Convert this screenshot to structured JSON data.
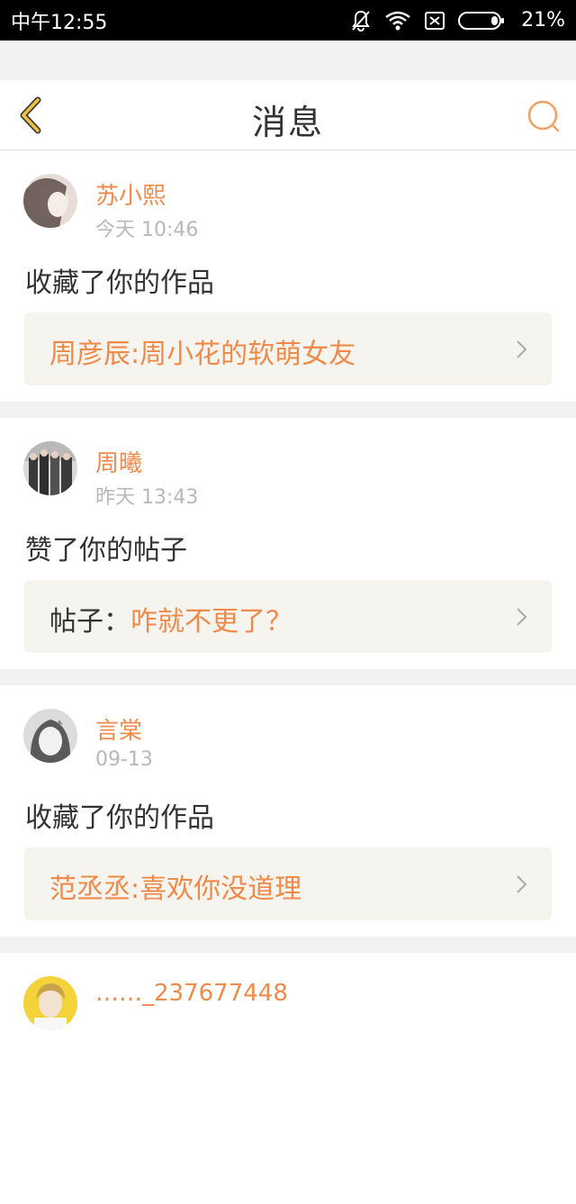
{
  "status_bar": {
    "time": "中午12:55",
    "battery": "21%",
    "icons": [
      "bell-muted-icon",
      "wifi-icon",
      "sim-off-icon",
      "battery-icon"
    ]
  },
  "header": {
    "title": "消息",
    "back_icon": "chevron-left-icon",
    "search_icon": "search-icon",
    "accent_color": "#f0b400"
  },
  "messages": [
    {
      "username": "苏小熙",
      "time": "今天 10:46",
      "action": "收藏了你的作品",
      "ref_prefix": "",
      "ref_title": "周彦辰:周小花的软萌女友"
    },
    {
      "username": "周曦",
      "time": "昨天 13:43",
      "action": "赞了你的帖子",
      "ref_prefix": "帖子：",
      "ref_title": "咋就不更了？"
    },
    {
      "username": "言棠",
      "time": "09-13",
      "action": "收藏了你的作品",
      "ref_prefix": "",
      "ref_title": "范丞丞:喜欢你没道理"
    },
    {
      "username": "……_237677448",
      "time": "",
      "action": "",
      "ref_prefix": "",
      "ref_title": ""
    }
  ],
  "colors": {
    "name": "#f08a4b",
    "ref_bg": "#f5f4ee",
    "text": "#333333",
    "muted": "#b8b8b8"
  }
}
